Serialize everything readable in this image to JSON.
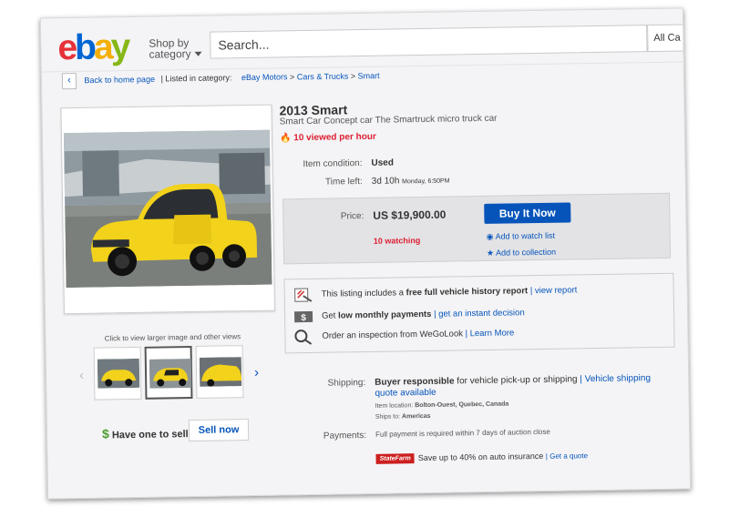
{
  "header": {
    "logo_letters": [
      "e",
      "b",
      "a",
      "y"
    ],
    "shop_by_line1": "Shop by",
    "shop_by_line2": "category",
    "search_placeholder": "Search...",
    "all_categories_label": "All Ca"
  },
  "breadcrumb": {
    "back_label": "Back to home page",
    "listed_in": "| Listed in category:",
    "items": [
      "eBay Motors",
      ">",
      "Cars & Trucks",
      ">",
      "Smart"
    ]
  },
  "gallery": {
    "click_hint": "Click to view larger image and other views"
  },
  "sell": {
    "question": "Have one to sell?",
    "button_label": "Sell now"
  },
  "listing": {
    "title": "2013 Smart",
    "subtitle": "Smart Car Concept car The Smartruck micro truck car",
    "viewed": "10 viewed per hour",
    "condition_label": "Item condition:",
    "condition_value": "Used",
    "time_left_label": "Time left:",
    "time_left_value": "3d 10h",
    "time_left_detail": "Monday, 6:50PM"
  },
  "price": {
    "label": "Price:",
    "value": "US $19,900.00",
    "watching": "10 watching",
    "buy_now_label": "Buy It Now",
    "watch_list_label": "Add to watch list",
    "collection_label": "Add to collection"
  },
  "history": {
    "row1_prefix": "This listing includes a ",
    "row1_bold": "free full vehicle history report",
    "row1_link": "| view report",
    "row2_prefix": "Get ",
    "row2_bold": "low monthly payments",
    "row2_link": "| get an instant decision",
    "row3_text": "Order an inspection from WeGoLook",
    "row3_link": "| Learn More"
  },
  "shipping": {
    "label": "Shipping:",
    "bold": "Buyer responsible",
    "text": " for vehicle pick-up or shipping",
    "link_line1": "| Vehicle shipping",
    "link_line2": "quote available",
    "item_location_label": "Item location:",
    "item_location_value": "Bolton-Ouest, Quebec, Canada",
    "ships_to_label": "Ships to:",
    "ships_to_value": "Americas"
  },
  "payments": {
    "label": "Payments:",
    "text": "Full payment is required within 7 days of auction close"
  },
  "insurance": {
    "badge": "StateFarm",
    "text": "Save up to 40% on auto insurance",
    "link": "| Get a quote"
  },
  "colors": {
    "ebay_red": "#e53238",
    "ebay_blue": "#0064d2",
    "ebay_yellow": "#f5af02",
    "ebay_green": "#86b817",
    "link_blue": "#0654ba",
    "alert_red": "#dd1e31",
    "car_yellow": "#f2d21b"
  }
}
